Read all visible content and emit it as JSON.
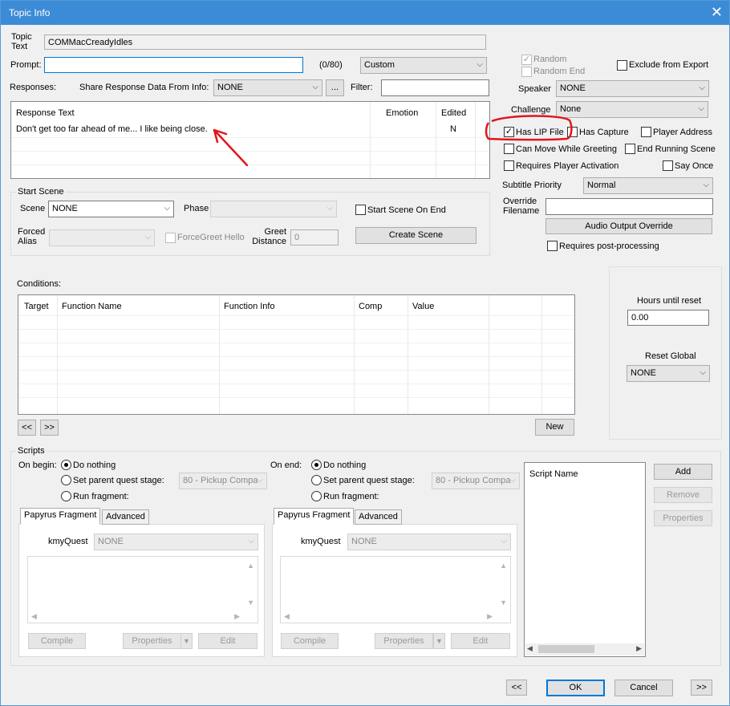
{
  "window": {
    "title": "Topic Info",
    "close_glyph": "✕"
  },
  "topic": {
    "label": "Topic Text",
    "value": "COMMacCreadyIdles"
  },
  "prompt": {
    "label": "Prompt:",
    "value": "",
    "counter": "(0/80)",
    "mode": "Custom"
  },
  "responses": {
    "label": "Responses:",
    "share_label": "Share Response Data From Info:",
    "share_value": "NONE",
    "ellipsis": "...",
    "filter_label": "Filter:",
    "filter_value": "",
    "columns": [
      "Response Text",
      "Emotion",
      "Edited"
    ],
    "rows": [
      {
        "text": "Don't get too far ahead of me... I like being close.",
        "emotion": "",
        "edited": "N"
      }
    ]
  },
  "right_panel": {
    "random_label": "Random",
    "random_end_label": "Random End",
    "exclude_label": "Exclude from Export",
    "speaker_label": "Speaker",
    "speaker_value": "NONE",
    "challenge_label": "Challenge",
    "challenge_value": "None",
    "has_lip_label": "Has LIP File",
    "has_capture_label": "Has Capture",
    "player_address_label": "Player Address",
    "can_move_label": "Can Move While Greeting",
    "end_running_label": "End Running Scene",
    "requires_activation_label": "Requires Player Activation",
    "say_once_label": "Say Once",
    "subtitle_label": "Subtitle Priority",
    "subtitle_value": "Normal",
    "override_label": "Override Filename",
    "override_value": "",
    "audio_override_button": "Audio Output Override",
    "post_processing_label": "Requires post-processing"
  },
  "start_scene": {
    "group_label": "Start Scene",
    "scene_label": "Scene",
    "scene_value": "NONE",
    "phase_label": "Phase",
    "phase_value": "",
    "start_on_end_label": "Start Scene On End",
    "forced_alias_label": "Forced Alias",
    "forced_alias_value": "",
    "force_greet_label": "ForceGreet Hello",
    "greet_distance_label": "Greet Distance",
    "greet_distance_value": "0",
    "create_scene_button": "Create Scene"
  },
  "conditions": {
    "label": "Conditions:",
    "columns": [
      "Target",
      "Function Name",
      "Function Info",
      "Comp",
      "Value"
    ],
    "prev_button": "<<",
    "next_button": ">>",
    "new_button": "New"
  },
  "reset": {
    "hours_label": "Hours until reset",
    "hours_value": "0.00",
    "global_label": "Reset Global",
    "global_value": "NONE"
  },
  "scripts": {
    "group_label": "Scripts",
    "on_begin": {
      "label": "On begin:",
      "do_nothing": "Do nothing",
      "set_stage": "Set parent quest stage:",
      "stage_value": "80 - Pickup Compa",
      "run_fragment": "Run fragment:"
    },
    "on_end": {
      "label": "On end:",
      "do_nothing": "Do nothing",
      "set_stage": "Set parent quest stage:",
      "stage_value": "80 - Pickup Compa",
      "run_fragment": "Run fragment:"
    },
    "left_fragment": {
      "tab_papyrus": "Papyrus Fragment",
      "tab_advanced": "Advanced",
      "quest_label": "kmyQuest",
      "quest_value": "NONE",
      "compile": "Compile",
      "properties": "Properties",
      "edit": "Edit"
    },
    "right_fragment": {
      "tab_papyrus": "Papyrus Fragment",
      "tab_advanced": "Advanced",
      "quest_label": "kmyQuest",
      "quest_value": "NONE",
      "compile": "Compile",
      "properties": "Properties",
      "edit": "Edit"
    },
    "script_list_header": "Script Name",
    "add_button": "Add",
    "remove_button": "Remove",
    "properties_button": "Properties"
  },
  "footer": {
    "prev": "<<",
    "ok": "OK",
    "cancel": "Cancel",
    "next": ">>"
  },
  "colors": {
    "titlebar": "#3c8bd6",
    "annotation": "#e0161c",
    "accent": "#0078d7"
  },
  "icons": {
    "dropdown": "chevron-down-icon",
    "check": "check-icon",
    "close": "close-icon"
  }
}
